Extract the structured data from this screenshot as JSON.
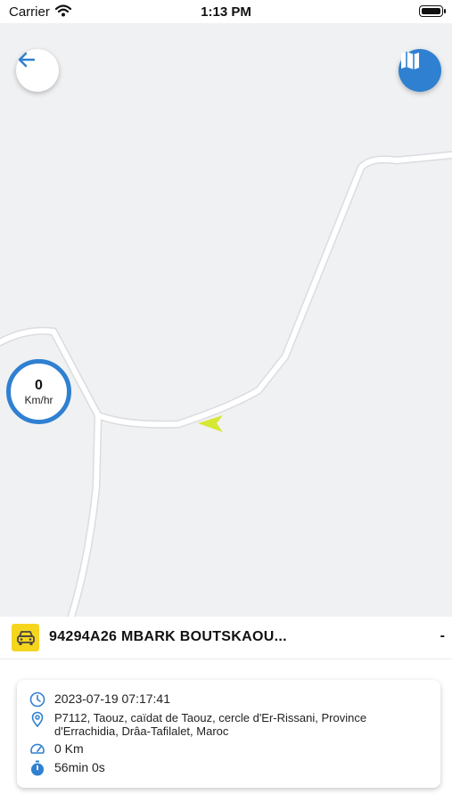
{
  "status_bar": {
    "carrier": "Carrier",
    "time": "1:13 PM"
  },
  "speed": {
    "value": "0",
    "unit": "Km/hr"
  },
  "vehicle": {
    "name": "94294A26 MBARK BOUTSKAOU...",
    "trailing": "-"
  },
  "trip": {
    "datetime": "2023-07-19 07:17:41",
    "address": "P7112, Taouz, caïdat de Taouz, cercle d'Er-Rissani, Province d'Errachidia, Drâa-Tafilalet, Maroc",
    "distance": "0 Km",
    "duration": "56min 0s"
  },
  "icons": {
    "wifi": "wifi-icon",
    "battery": "battery-icon",
    "back": "arrow-left-icon",
    "map": "map-icon",
    "car": "car-icon",
    "clock": "clock-icon",
    "location": "location-pin-icon",
    "speedometer": "speedometer-icon",
    "stopwatch": "stopwatch-icon",
    "marker": "vehicle-direction-marker-icon"
  },
  "colors": {
    "accent": "#2f80d1",
    "vehicle_badge": "#f6d51e",
    "marker": "#d6e833"
  }
}
